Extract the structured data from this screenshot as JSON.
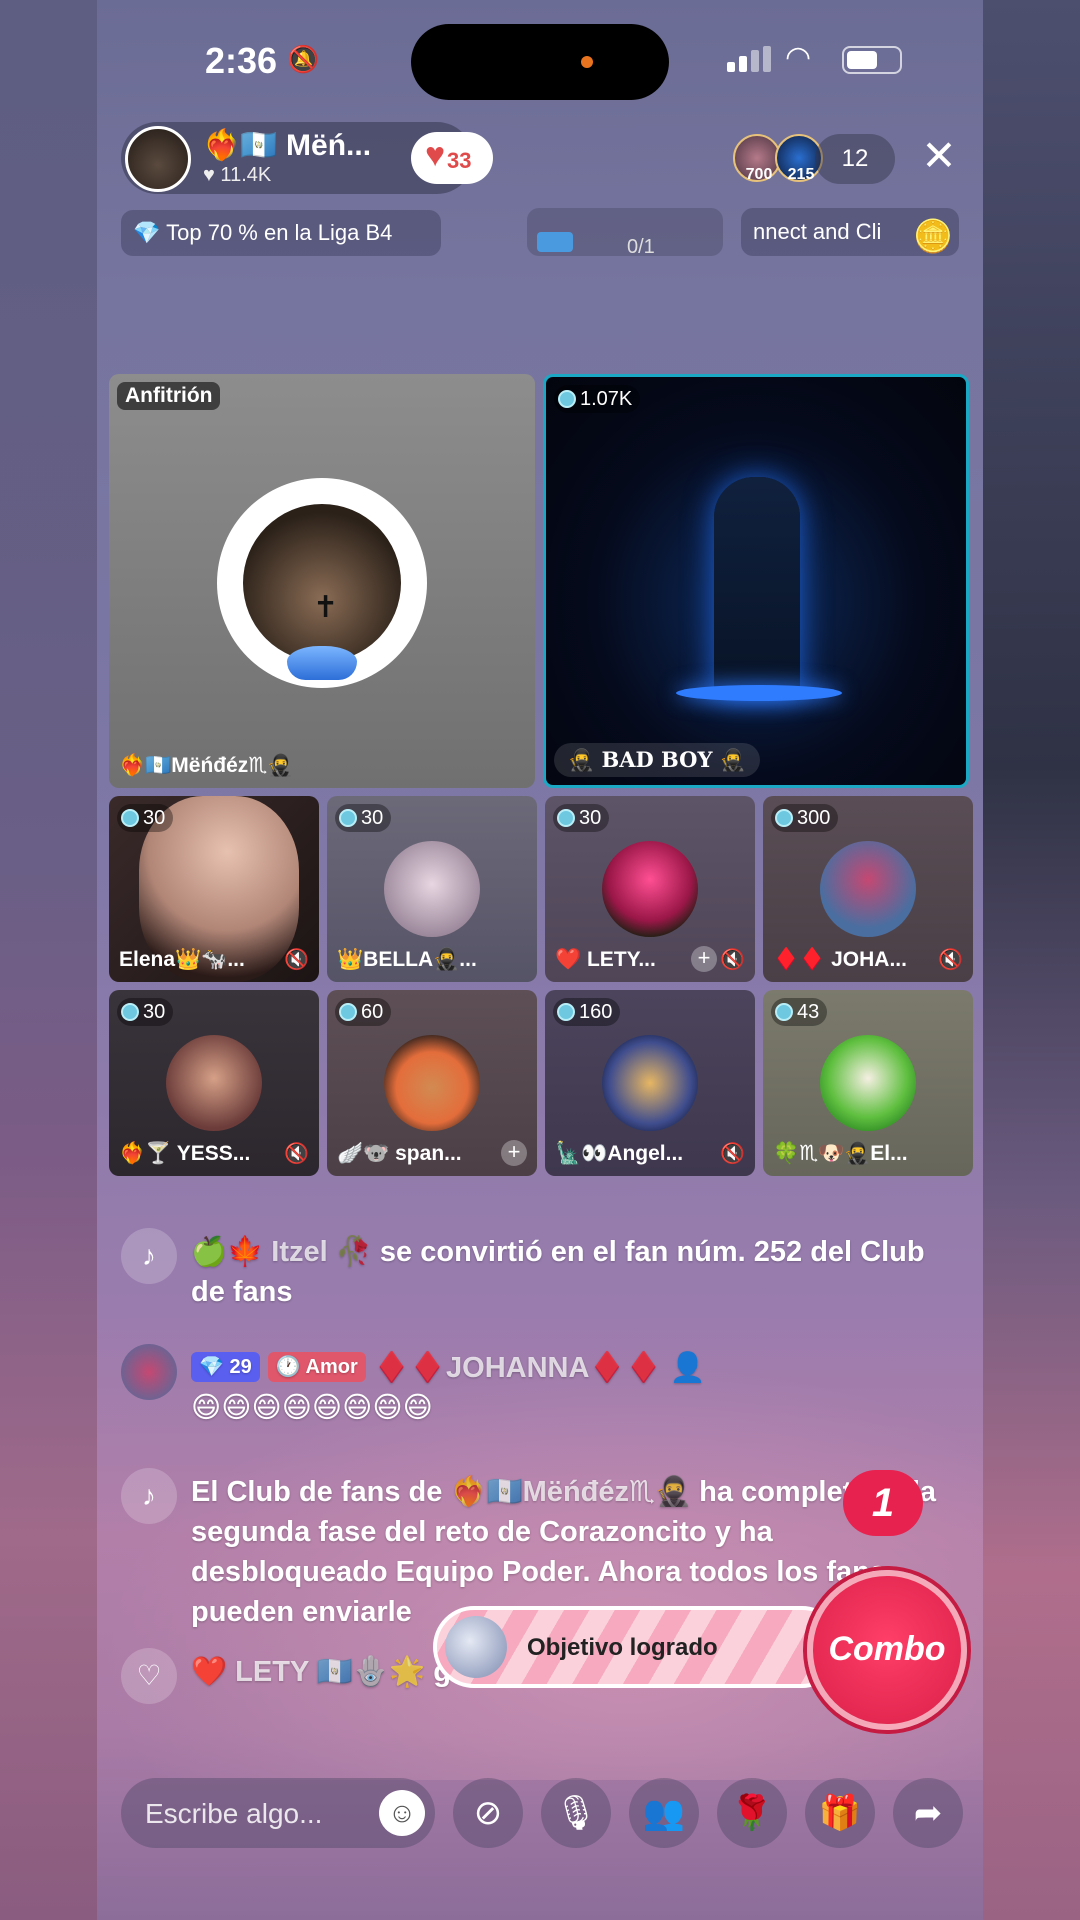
{
  "status": {
    "time": "2:36"
  },
  "header": {
    "host_name": "❤️‍🔥🇬🇹 Mëń...",
    "host_likes": "♥ 11.4K",
    "fan_level": "33",
    "viewer_avatars": [
      {
        "count": "700"
      },
      {
        "count": "215"
      }
    ],
    "viewer_count": "12",
    "league": "Top 70 % en la Liga B4",
    "goal": "0/1",
    "connect": "nnect and Cli"
  },
  "grid": {
    "host": {
      "tag": "Anfitrión",
      "name": "❤️‍🔥🇬🇹Mëńđéz♏🥷"
    },
    "featured": {
      "coins": "1.07K",
      "name": "BAD BOY"
    },
    "guests": [
      {
        "coins": "30",
        "name": "Elena👑🐄..."
      },
      {
        "coins": "30",
        "name": "👑BELLA🥷..."
      },
      {
        "coins": "30",
        "name": "❤️ LETY..."
      },
      {
        "coins": "300",
        "name": "♦️♦️ JOHA..."
      },
      {
        "coins": "30",
        "name": "❤️‍🔥🍸 YESS..."
      },
      {
        "coins": "60",
        "name": "🪽🐨 span..."
      },
      {
        "coins": "160",
        "name": "🗽👀Angel..."
      },
      {
        "coins": "43",
        "name": "🍀♏🐶🥷El..."
      }
    ]
  },
  "chat": [
    {
      "prefix": "🍏🍁 ",
      "user": "Itzel 🥀",
      "text": " se convirtió en el fan núm. 252 del Club de fans"
    },
    {
      "level": "💎 29",
      "badge": "🕐 Amor",
      "user": "♦️♦️JOHANNA♦️♦️",
      "text": "😄😄😄😄😄😄😄😄"
    },
    {
      "prefix": "El Club de fans de ",
      "user": "❤️‍🔥🇬🇹Mëńđéz♏🥷",
      "text": " ha completado la segunda fase del reto de Corazoncito y ha desbloqueado Equipo Poder. Ahora todos los fans pueden enviarle"
    },
    {
      "prefix": "❤️ ",
      "user": "LETY 🇬🇹🪬🌟",
      "text": " gusta al LIVE"
    }
  ],
  "objective": "Objetivo logrado",
  "combo": {
    "label": "Combo",
    "count": "1"
  },
  "composer": {
    "placeholder": "Escribe algo..."
  },
  "icons": {
    "bell": "bell-slash-icon",
    "tiktok": "tiktok-note-icon",
    "heart": "heart-icon"
  }
}
